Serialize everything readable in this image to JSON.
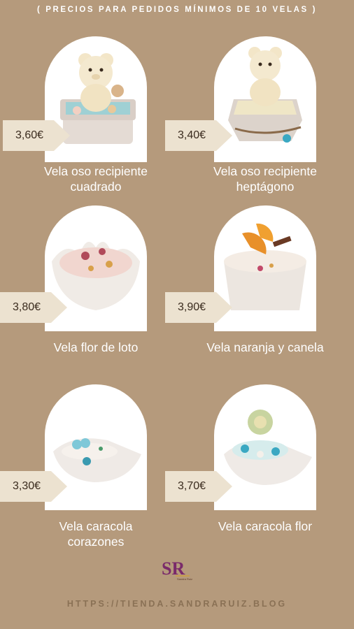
{
  "header": "( PRECIOS PARA PEDIDOS MÍNIMOS DE 10 VELAS )",
  "products": [
    {
      "name_line1": "Vela oso recipiente",
      "name_line2": "cuadrado",
      "price": "3,60€"
    },
    {
      "name_line1": "Vela oso recipiente",
      "name_line2": "heptágono",
      "price": "3,40€"
    },
    {
      "name_line1": "Vela flor de loto",
      "name_line2": "",
      "price": "3,80€"
    },
    {
      "name_line1": "Vela naranja y canela",
      "name_line2": "",
      "price": "3,90€"
    },
    {
      "name_line1": "Vela caracola",
      "name_line2": "corazones",
      "price": "3,30€"
    },
    {
      "name_line1": "Vela caracola flor",
      "name_line2": "",
      "price": "3,70€"
    }
  ],
  "logo": {
    "letters": "SR",
    "caption": "Sandra Ruiz"
  },
  "footer_url": "HTTPS://TIENDA.SANDRARUIZ.BLOG",
  "colors": {
    "background": "#b59a7c",
    "tag": "#ece2d0",
    "accent_logo": "#7a2a6a"
  }
}
